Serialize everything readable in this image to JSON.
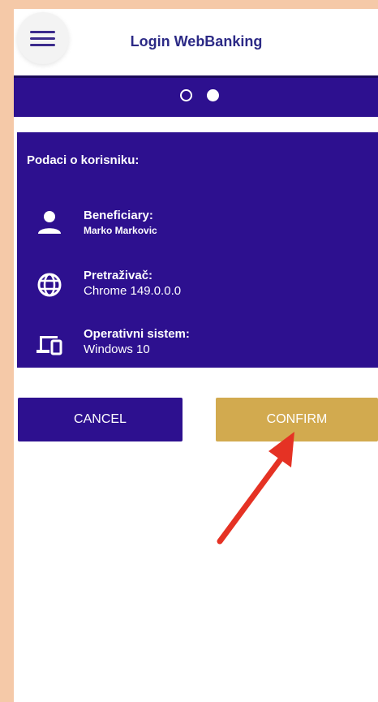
{
  "app_bar": {
    "title": "Login WebBanking",
    "menu_icon": "hamburger-menu-icon"
  },
  "stepper": {
    "steps": 2,
    "current_step": 2
  },
  "user_info": {
    "heading": "Podaci o korisniku:",
    "beneficiary": {
      "label": "Beneficiary:",
      "value": "Marko Markovic",
      "icon": "person-icon"
    },
    "browser": {
      "label": "Pretraživač:",
      "value": "Chrome 149.0.0.0",
      "icon": "globe-icon"
    },
    "os": {
      "label": "Operativni sistem:",
      "value": "Windows 10",
      "icon": "devices-icon"
    }
  },
  "actions": {
    "cancel_label": "CANCEL",
    "confirm_label": "CONFIRM"
  },
  "colors": {
    "primary": "#2d108f",
    "confirm": "#d2aa4f",
    "annotation_arrow": "#e53224",
    "outer_background": "#f5c9a8"
  }
}
